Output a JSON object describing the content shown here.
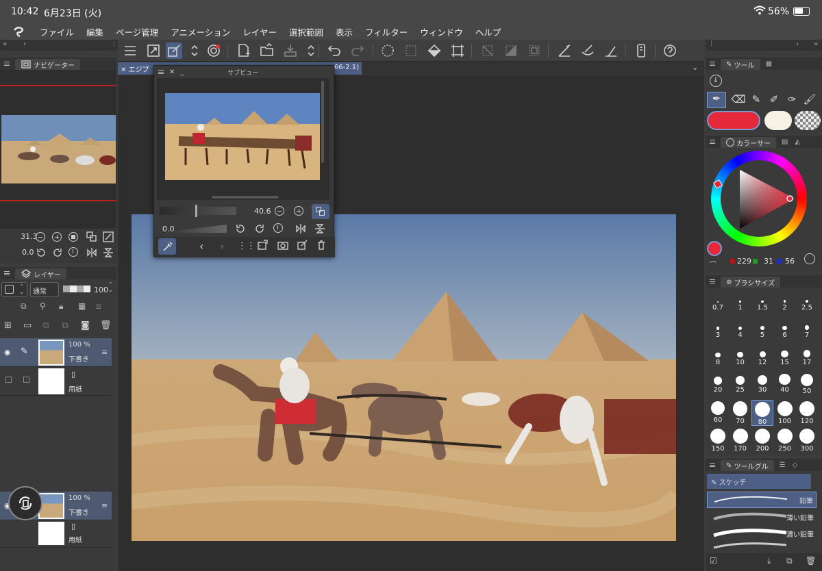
{
  "status": {
    "time": "10:42",
    "date": "6月23日 (火)",
    "battery": "56%"
  },
  "menu": [
    "ファイル",
    "編集",
    "ページ管理",
    "アニメーション",
    "レイヤー",
    "選択範囲",
    "表示",
    "フィルター",
    "ウィンドウ",
    "ヘルプ"
  ],
  "navigator": {
    "title": "ナビゲーター",
    "zoom": "31.3",
    "rotate": "0.0"
  },
  "layers": {
    "title": "レイヤー",
    "blend": "通常",
    "opacity": "100",
    "items": [
      {
        "pct": "100 %",
        "name": "下書き"
      },
      {
        "name": "用紙"
      }
    ],
    "items2": [
      {
        "pct": "100 %",
        "name": "下書き"
      },
      {
        "name": "用紙"
      }
    ]
  },
  "subview": {
    "title": "サブビュー",
    "zoom": "40.6",
    "rotate": "0.0"
  },
  "doc_tab": {
    "left": "エジプ",
    "right": "66-2.1)"
  },
  "tool": {
    "title": "ツール"
  },
  "color": {
    "title": "カラーサー",
    "r": "229",
    "g": "31",
    "b": "56",
    "main": "#e5283a"
  },
  "brush": {
    "title": "ブラシサイズ",
    "sizes": [
      "0.7",
      "1",
      "1.5",
      "2",
      "2.5",
      "3",
      "4",
      "5",
      "6",
      "7",
      "8",
      "10",
      "12",
      "15",
      "17",
      "20",
      "25",
      "30",
      "40",
      "50",
      "60",
      "70",
      "80",
      "100",
      "120",
      "150",
      "170",
      "200",
      "250",
      "300"
    ],
    "selected": "80"
  },
  "toolgroup": {
    "title": "ツールグル",
    "group": "スケッチ",
    "items": [
      "鉛筆",
      "薄い鉛筆",
      "濃い鉛筆"
    ]
  }
}
